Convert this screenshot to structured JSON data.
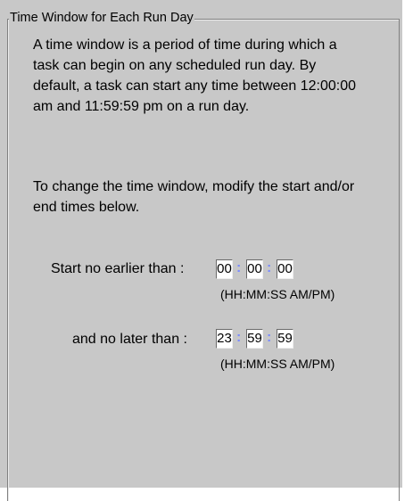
{
  "group": {
    "title": "Time Window for Each Run Day"
  },
  "description": {
    "intro": "A time window is a period of time during which a task can begin on any scheduled run day. By default, a task can start any time between 12:00:00 am and 11:59:59 pm on a run day.",
    "instruction": "To change the time window, modify the start and/or end times below."
  },
  "start_time": {
    "label": "Start no earlier than :",
    "hours": "00",
    "minutes": "00",
    "seconds": "00",
    "format_hint": "(HH:MM:SS AM/PM)"
  },
  "end_time": {
    "label": "and no later than :",
    "hours": "23",
    "minutes": "59",
    "seconds": "59",
    "format_hint": "(HH:MM:SS AM/PM)"
  },
  "separator": ":",
  "colors": {
    "panel_background": "#c8c8c8",
    "field_background": "#ffffff",
    "separator_color": "#7c8cff"
  }
}
